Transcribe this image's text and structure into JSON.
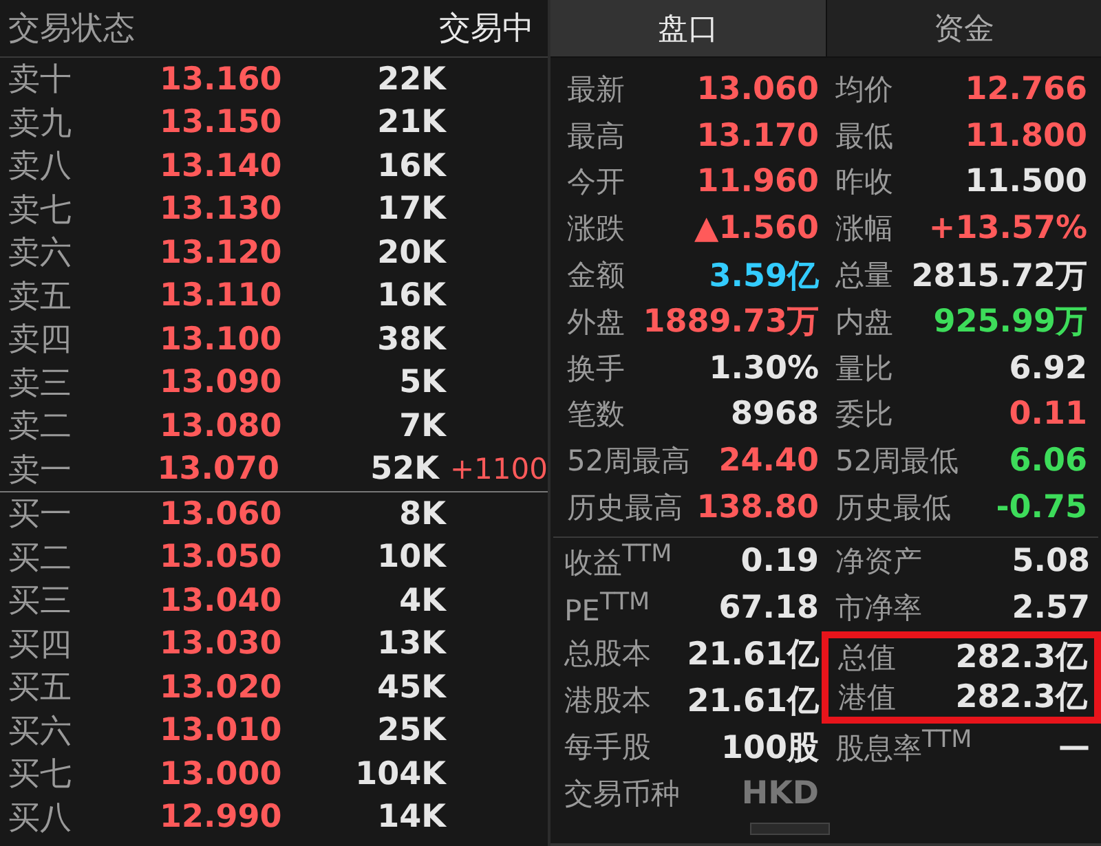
{
  "status": {
    "label": "交易状态",
    "value": "交易中"
  },
  "asks": [
    {
      "label": "卖十",
      "price": "13.160",
      "volume": "22K"
    },
    {
      "label": "卖九",
      "price": "13.150",
      "volume": "21K"
    },
    {
      "label": "卖八",
      "price": "13.140",
      "volume": "16K"
    },
    {
      "label": "卖七",
      "price": "13.130",
      "volume": "17K"
    },
    {
      "label": "卖六",
      "price": "13.120",
      "volume": "20K"
    },
    {
      "label": "卖五",
      "price": "13.110",
      "volume": "16K"
    },
    {
      "label": "卖四",
      "price": "13.100",
      "volume": "38K"
    },
    {
      "label": "卖三",
      "price": "13.090",
      "volume": "5K"
    },
    {
      "label": "卖二",
      "price": "13.080",
      "volume": "7K"
    },
    {
      "label": "卖一",
      "price": "13.070",
      "volume": "52K",
      "change": "+1100"
    }
  ],
  "bids": [
    {
      "label": "买一",
      "price": "13.060",
      "volume": "8K"
    },
    {
      "label": "买二",
      "price": "13.050",
      "volume": "10K"
    },
    {
      "label": "买三",
      "price": "13.040",
      "volume": "4K"
    },
    {
      "label": "买四",
      "price": "13.030",
      "volume": "13K"
    },
    {
      "label": "买五",
      "price": "13.020",
      "volume": "45K"
    },
    {
      "label": "买六",
      "price": "13.010",
      "volume": "25K"
    },
    {
      "label": "买七",
      "price": "13.000",
      "volume": "104K"
    },
    {
      "label": "买八",
      "price": "12.990",
      "volume": "14K"
    }
  ],
  "tabs": [
    {
      "label": "盘口",
      "selected": true
    },
    {
      "label": "资金",
      "selected": false
    }
  ],
  "stats": [
    {
      "label": "最新",
      "value": "13.060",
      "color": "#ff5a5a"
    },
    {
      "label": "均价",
      "value": "12.766",
      "color": "#ff5a5a"
    },
    {
      "label": "最高",
      "value": "13.170",
      "color": "#ff5a5a"
    },
    {
      "label": "最低",
      "value": "11.800",
      "color": "#ff5a5a"
    },
    {
      "label": "今开",
      "value": "11.960",
      "color": "#ff5a5a"
    },
    {
      "label": "昨收",
      "value": "11.500",
      "color": "#e6e6e6"
    },
    {
      "label": "涨跌",
      "value": "▲1.560",
      "color": "#ff5a5a"
    },
    {
      "label": "涨幅",
      "value": "+13.57%",
      "color": "#ff5a5a"
    },
    {
      "label": "金额",
      "value": "3.59亿",
      "color": "#33ccff"
    },
    {
      "label": "总量",
      "value": "2815.72万",
      "color": "#e6e6e6"
    },
    {
      "label": "外盘",
      "value": "1889.73万",
      "color": "#ff5a5a"
    },
    {
      "label": "内盘",
      "value": "925.99万",
      "color": "#3ddc5a"
    },
    {
      "label": "换手",
      "value": "1.30%",
      "color": "#e6e6e6"
    },
    {
      "label": "量比",
      "value": "6.92",
      "color": "#e6e6e6"
    },
    {
      "label": "笔数",
      "value": "8968",
      "color": "#e6e6e6"
    },
    {
      "label": "委比",
      "value": "0.11",
      "color": "#ff5a5a"
    },
    {
      "label": "52周最高",
      "value": "24.40",
      "color": "#ff5a5a"
    },
    {
      "label": "52周最低",
      "value": "6.06",
      "color": "#3ddc5a"
    },
    {
      "label": "历史最高",
      "value": "138.80",
      "color": "#ff5a5a"
    },
    {
      "label": "历史最低",
      "value": "-0.75",
      "color": "#3ddc5a"
    }
  ],
  "fundamentals": [
    {
      "label": "收益$^{TTM}$",
      "value": "0.19",
      "color": "#e6e6e6",
      "boxed": false
    },
    {
      "label": "净资产",
      "value": "5.08",
      "color": "#e6e6e6",
      "boxed": false
    },
    {
      "label": "PE$^{TTM}$",
      "value": "67.18",
      "color": "#e6e6e6",
      "boxed": false
    },
    {
      "label": "市净率",
      "value": "2.57",
      "color": "#e6e6e6",
      "boxed": false
    },
    {
      "label": "总股本",
      "value": "21.61亿",
      "color": "#e6e6e6",
      "boxed": false
    },
    {
      "label": "总值",
      "value": "282.3亿",
      "color": "#e6e6e6",
      "boxed": true
    },
    {
      "label": "港股本",
      "value": "21.61亿",
      "color": "#e6e6e6",
      "boxed": false
    },
    {
      "label": "港值",
      "value": "282.3亿",
      "color": "#e6e6e6",
      "boxed": true
    },
    {
      "label": "每手股",
      "value": "100股",
      "color": "#e6e6e6",
      "boxed": false
    },
    {
      "label": "股息率$^{TTM}$",
      "value": "—",
      "color": "#e6e6e6",
      "boxed": false
    },
    {
      "label": "交易币种",
      "value": "HKD",
      "color": "#777777",
      "boxed": false
    }
  ]
}
